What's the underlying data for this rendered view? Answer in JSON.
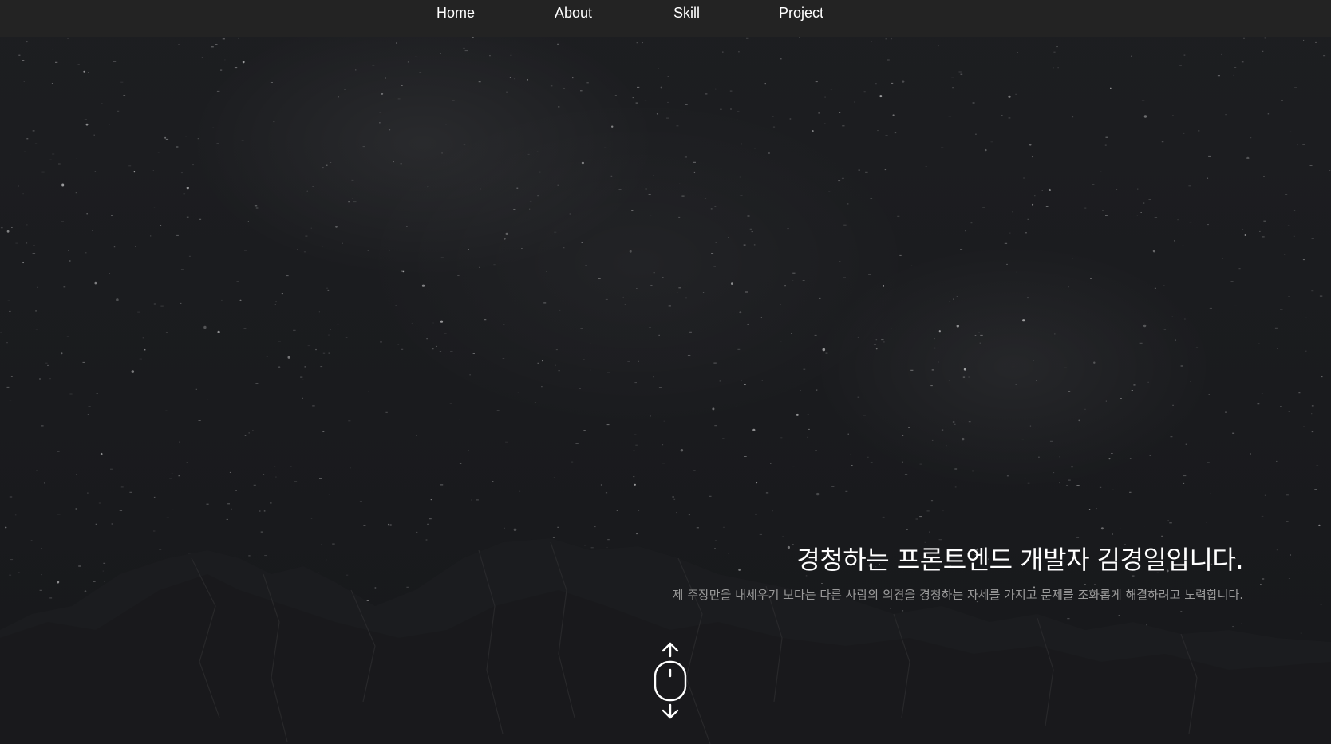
{
  "nav": {
    "items": [
      {
        "label": "Home"
      },
      {
        "label": "About"
      },
      {
        "label": "Skill"
      },
      {
        "label": "Project"
      }
    ]
  },
  "hero": {
    "headline": "경청하는 프론트엔드 개발자 김경일입니다.",
    "subtitle": "제 주장만을 내세우기 보다는 다른 사람의 의견을 경청하는 자세를 가지고 문제를 조화롭게 해결하려고 노력합니다."
  },
  "icons": {
    "scroll": "mouse-scroll-icon"
  },
  "colors": {
    "nav_background": "#232323",
    "page_background": "#18191c",
    "headline": "#ffffff",
    "subtitle": "#9a9a9a"
  }
}
